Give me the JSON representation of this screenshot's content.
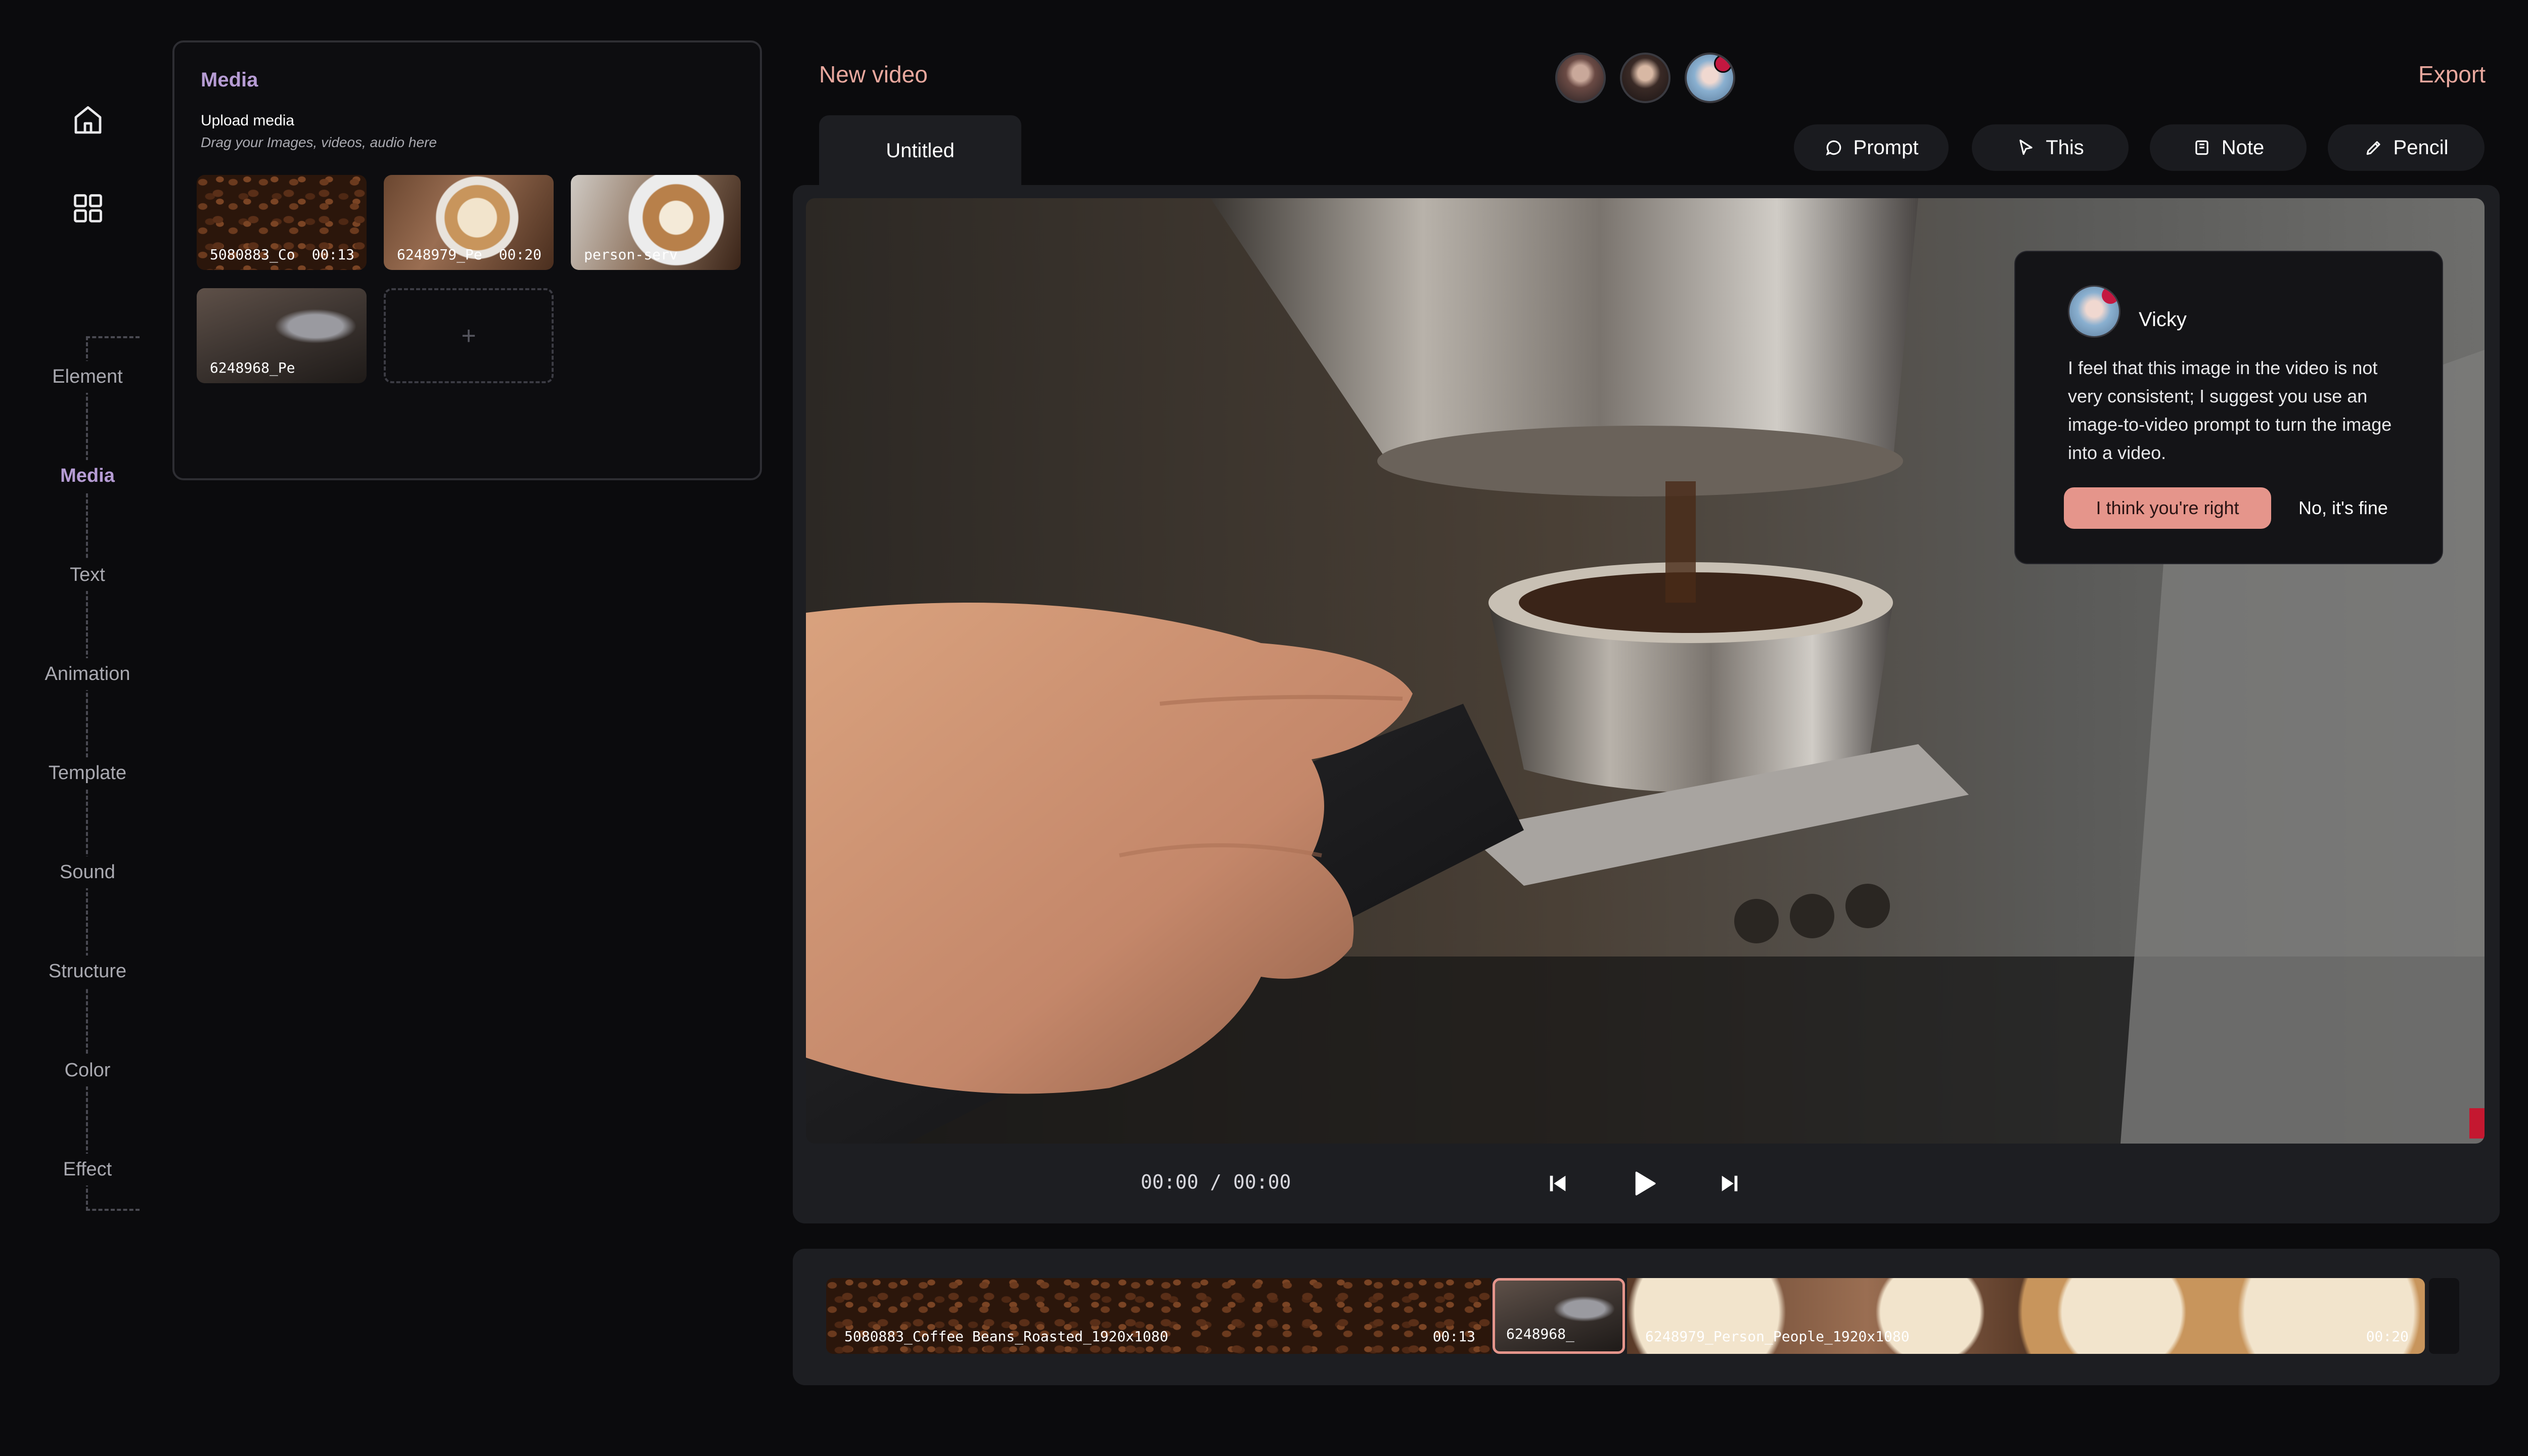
{
  "rail": {
    "home_icon": "home-icon",
    "grid_icon": "grid-icon",
    "items": [
      {
        "label": "Element",
        "active": false
      },
      {
        "label": "Media",
        "active": true
      },
      {
        "label": "Text",
        "active": false
      },
      {
        "label": "Animation",
        "active": false
      },
      {
        "label": "Template",
        "active": false
      },
      {
        "label": "Sound",
        "active": false
      },
      {
        "label": "Structure",
        "active": false
      },
      {
        "label": "Color",
        "active": false
      },
      {
        "label": "Effect",
        "active": false
      }
    ]
  },
  "media": {
    "title": "Media",
    "upload_title": "Upload media",
    "upload_sub": "Drag your Images, videos, audio here",
    "thumbs": [
      {
        "label": "5080883_Co",
        "duration": "00:13"
      },
      {
        "label": "6248979_Pe",
        "duration": "00:20"
      },
      {
        "label": "person-serv",
        "duration": ""
      },
      {
        "label": "6248968_Pe",
        "duration": ""
      }
    ],
    "add_label": "+"
  },
  "header": {
    "title": "New video",
    "export": "Export",
    "tab": "Untitled",
    "tools": [
      {
        "label": "Prompt",
        "icon": "chat-bubble-icon"
      },
      {
        "label": "This",
        "icon": "cursor-icon"
      },
      {
        "label": "Note",
        "icon": "note-icon"
      },
      {
        "label": "Pencil",
        "icon": "pencil-icon"
      }
    ]
  },
  "player": {
    "timecode": "00:00 / 00:00"
  },
  "comment": {
    "name": "Vicky",
    "text": "I feel that this image in the video is not very consistent; I suggest you use an image-to-video prompt to turn the image into a video.",
    "accept": "I think you're right",
    "decline": "No, it's fine"
  },
  "timeline": {
    "clips": [
      {
        "label": "5080883_Coffee Beans_Roasted_1920x1080",
        "duration": "00:13"
      },
      {
        "label": "6248968_",
        "duration": ""
      },
      {
        "label": "6248979_Person_People_1920x1080",
        "duration": "00:20"
      }
    ]
  },
  "colors": {
    "accent": "#e9a89e",
    "active_nav": "#b69cd4",
    "panel": "#1d1e22",
    "background": "#0b0b0d"
  }
}
